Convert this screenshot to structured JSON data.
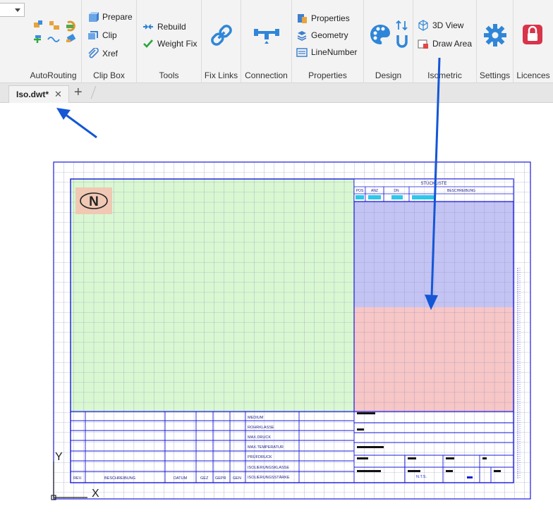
{
  "ribbon": {
    "groups": {
      "autorouting": "AutoRouting",
      "clipbox": "Clip Box",
      "tools": "Tools",
      "fixlinks": "Fix Links",
      "connection": "Connection",
      "properties": "Properties",
      "design": "Design",
      "isometric": "Isometric",
      "settings": "Settings",
      "licences": "Licences"
    },
    "clipbox": {
      "prepare": "Prepare",
      "clip": "Clip",
      "xref": "Xref"
    },
    "tools": {
      "rebuild": "Rebuild",
      "weightfix": "Weight Fix"
    },
    "properties": {
      "properties": "Properties",
      "geometry": "Geometry",
      "linenumber": "LineNumber"
    },
    "isometric": {
      "view3d": "3D View",
      "drawarea": "Draw Area"
    }
  },
  "tabs": {
    "active": "Iso.dwt*",
    "close_glyph": "✕",
    "add_glyph": "+"
  },
  "drawing": {
    "north_letter": "N",
    "parts_list": {
      "title": "STÜCKLISTE",
      "headers": [
        "POS",
        "ANZ",
        "DN",
        "BESCHREIBUNG"
      ]
    },
    "title_block": {
      "fields": [
        "MEDIUM",
        "ROHRKLASSE",
        "MAX.DRUCK",
        "MAX.TEMPERATUR",
        "PRÜFDRUCK",
        "ISOLIERUNGSKLASSE",
        "ISOLIERUNGSSTÄRKE"
      ],
      "footer": [
        "REV.",
        "BESCHREIBUNG",
        "DATUM",
        "GEZ",
        "GEPR",
        "GEN"
      ],
      "scale": "N.T.S."
    },
    "axis": {
      "y": "Y",
      "x": "X"
    }
  },
  "colors": {
    "grid": "#8a8fb0",
    "border": "#1a1adc",
    "green_area": "#d9f8d2",
    "blue_area": "#c4c4f4",
    "red_area": "#f7c6c6",
    "north_box": "#f0c8b4",
    "arrow": "#1456d6"
  }
}
